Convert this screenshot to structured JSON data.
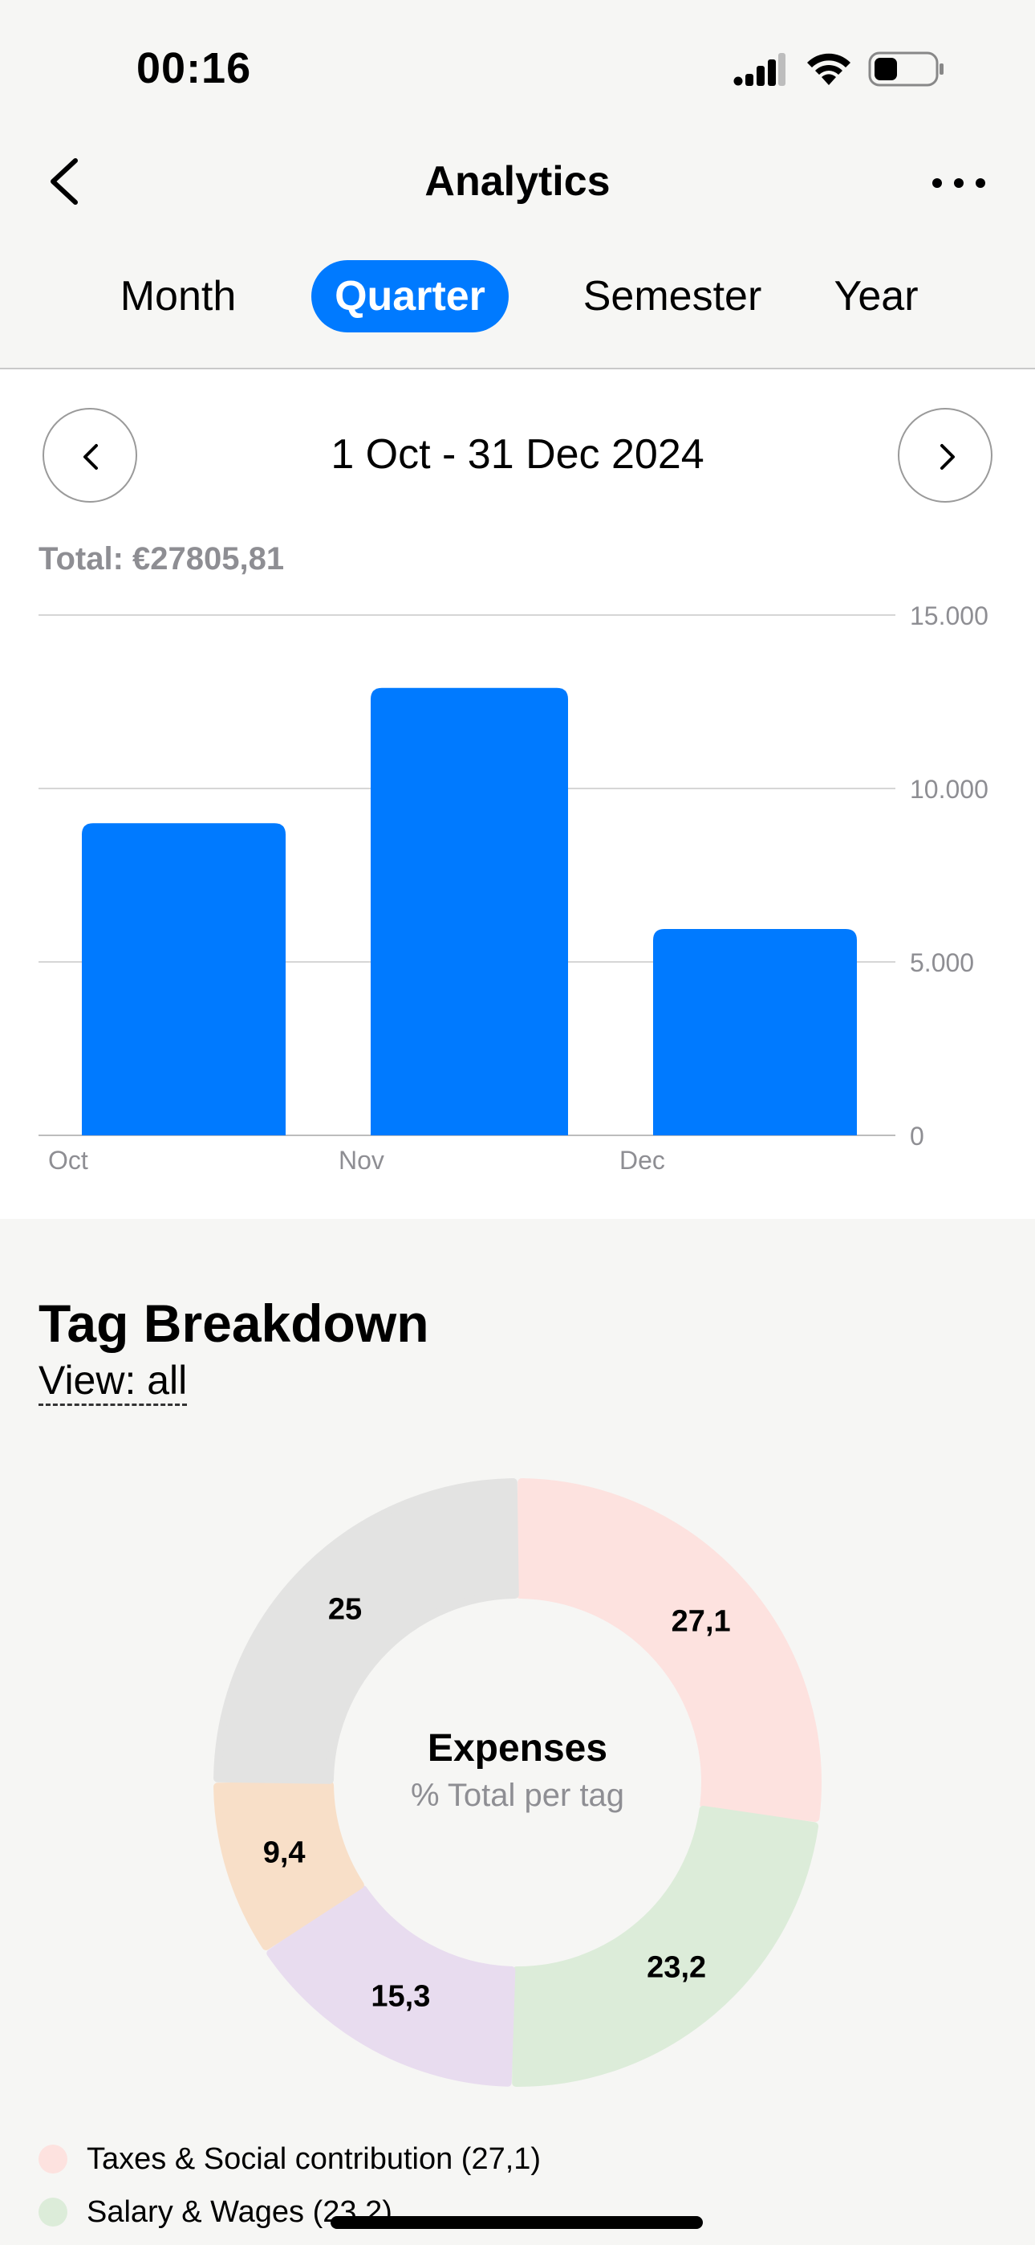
{
  "status_bar": {
    "time": "00:16"
  },
  "header": {
    "title": "Analytics"
  },
  "period_tabs": [
    {
      "label": "Month",
      "active": false
    },
    {
      "label": "Quarter",
      "active": true
    },
    {
      "label": "Semester",
      "active": false
    },
    {
      "label": "Year",
      "active": false
    }
  ],
  "date_range": {
    "label": "1 Oct - 31 Dec 2024"
  },
  "total": {
    "label": "Total: €27805,81"
  },
  "chart_data": {
    "type": "bar",
    "categories": [
      "Oct",
      "Nov",
      "Dec"
    ],
    "values": [
      9000,
      12900,
      5950
    ],
    "y_ticks": [
      "15.000",
      "10.000",
      "5.000",
      "0"
    ],
    "ylim": [
      0,
      15000
    ],
    "color": "#007aff",
    "grid": true
  },
  "tag_breakdown": {
    "title": "Tag Breakdown",
    "view_label": "View: all",
    "center_title": "Expenses",
    "center_subtitle": "% Total per tag",
    "slices": [
      {
        "value": 27.1,
        "label": "27,1",
        "color": "#fde2df"
      },
      {
        "value": 23.2,
        "label": "23,2",
        "color": "#dcecd9"
      },
      {
        "value": 15.3,
        "label": "15,3",
        "color": "#e8dcef"
      },
      {
        "value": 9.4,
        "label": "9,4",
        "color": "#f8dfc8"
      },
      {
        "value": 25,
        "label": "25",
        "color": "#e3e3e2"
      }
    ],
    "legend": [
      {
        "label": "Taxes & Social contribution (27,1)",
        "color": "#fde2df"
      },
      {
        "label": "Salary & Wages (23,2)",
        "color": "#dcecd9"
      }
    ]
  }
}
